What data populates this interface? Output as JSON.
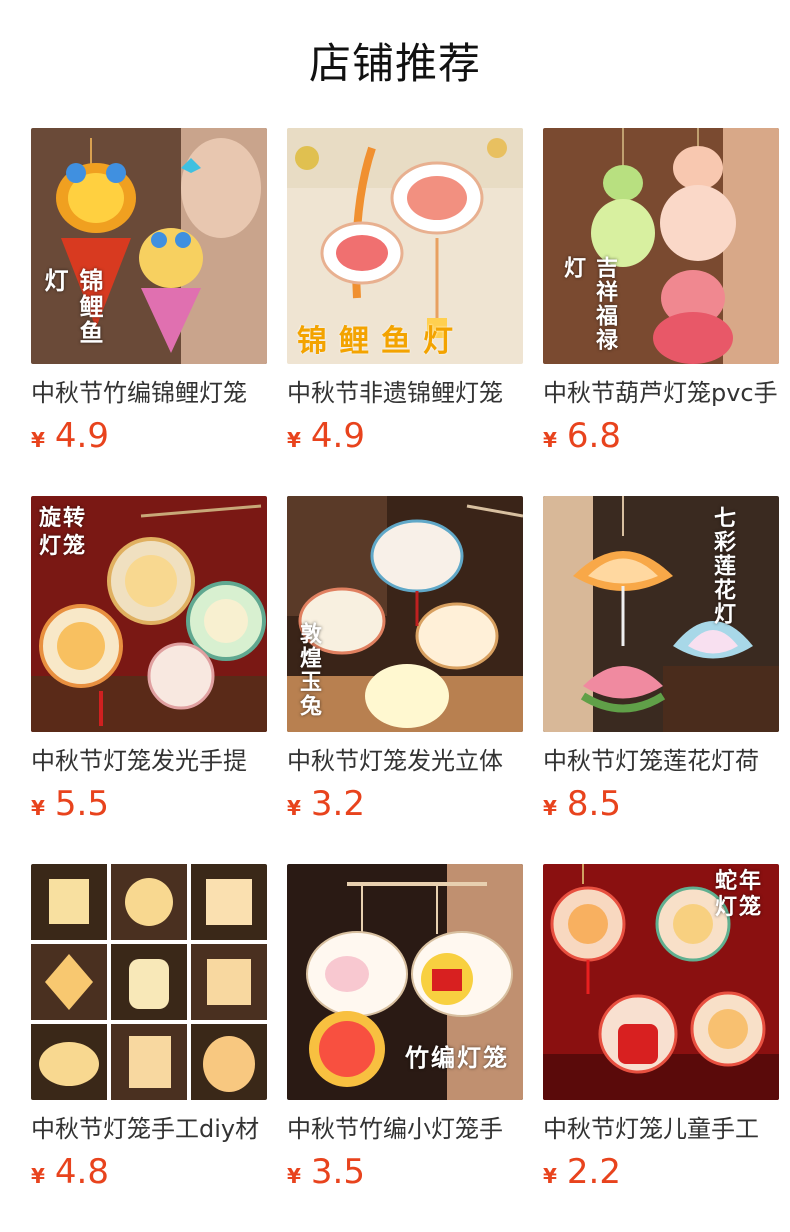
{
  "page": {
    "title": "店铺推荐",
    "currency_symbol": "¥",
    "accent_color": "#e8431d"
  },
  "products": [
    {
      "title": "中秋节竹编锦鲤灯笼",
      "price": "4.9",
      "image_icon": "koi-lantern-icon",
      "overlay": "锦鲤鱼灯"
    },
    {
      "title": "中秋节非遗锦鲤灯笼",
      "price": "4.9",
      "image_icon": "koi-fish-lantern-icon",
      "overlay": "锦鲤鱼灯"
    },
    {
      "title": "中秋节葫芦灯笼pvc手",
      "price": "6.8",
      "image_icon": "gourd-lantern-icon",
      "overlay": "吉祥福禄灯"
    },
    {
      "title": "中秋节灯笼发光手提",
      "price": "5.5",
      "image_icon": "rotating-lantern-icon",
      "overlay": "旋转灯笼"
    },
    {
      "title": "中秋节灯笼发光立体",
      "price": "3.2",
      "image_icon": "rabbit-lantern-icon",
      "overlay": "敦煌玉兔"
    },
    {
      "title": "中秋节灯笼莲花灯荷",
      "price": "8.5",
      "image_icon": "lotus-lantern-icon",
      "overlay": "七彩莲花灯"
    },
    {
      "title": "中秋节灯笼手工diy材",
      "price": "4.8",
      "image_icon": "diy-lantern-grid-icon",
      "overlay": ""
    },
    {
      "title": "中秋节竹编小灯笼手",
      "price": "3.5",
      "image_icon": "bamboo-rabbit-lantern-icon",
      "overlay": "竹编灯笼"
    },
    {
      "title": "中秋节灯笼儿童手工",
      "price": "2.2",
      "image_icon": "snake-year-lantern-icon",
      "overlay": "蛇年灯笼"
    }
  ]
}
